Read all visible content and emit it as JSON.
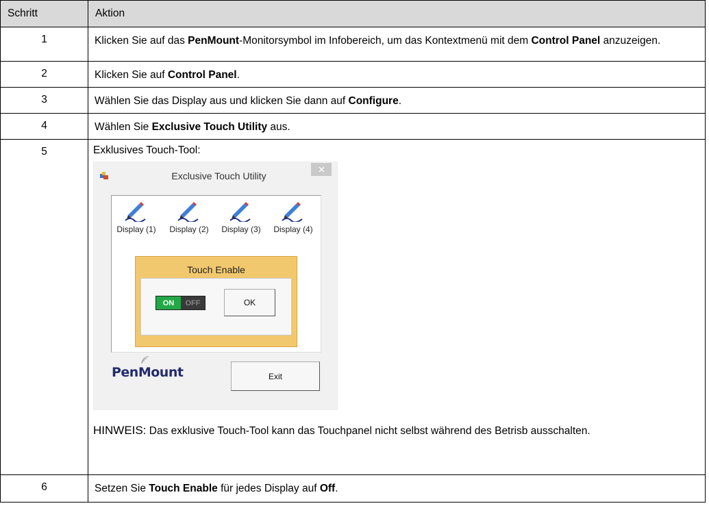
{
  "header": {
    "step": "Schritt",
    "action": "Aktion"
  },
  "rows": [
    {
      "num": "1",
      "parts": [
        {
          "t": "Klicken Sie auf das ",
          "b": false
        },
        {
          "t": "PenMount",
          "b": true
        },
        {
          "t": "-Monitorsymbol im Infobereich, um das Kontextmenü mit dem ",
          "b": false
        },
        {
          "t": "Control Panel",
          "b": true
        },
        {
          "t": " anzuzeigen.",
          "b": false
        }
      ]
    },
    {
      "num": "2",
      "parts": [
        {
          "t": "Klicken Sie auf ",
          "b": false
        },
        {
          "t": "Control Panel",
          "b": true
        },
        {
          "t": ".",
          "b": false
        }
      ]
    },
    {
      "num": "3",
      "parts": [
        {
          "t": "Wählen Sie das Display aus und klicken Sie dann auf ",
          "b": false
        },
        {
          "t": "Configure",
          "b": true
        },
        {
          "t": ".",
          "b": false
        }
      ]
    },
    {
      "num": "4",
      "parts": [
        {
          "t": "Wählen Sie ",
          "b": false
        },
        {
          "t": "Exclusive Touch Utility",
          "b": true
        },
        {
          "t": " aus.",
          "b": false
        }
      ]
    },
    {
      "num": "5"
    },
    {
      "num": "6",
      "parts": [
        {
          "t": "Setzen Sie ",
          "b": false
        },
        {
          "t": "Touch Enable",
          "b": true
        },
        {
          "t": " für jedes Display auf ",
          "b": false
        },
        {
          "t": "Off",
          "b": true
        },
        {
          "t": ".",
          "b": false
        }
      ]
    }
  ],
  "step5": {
    "intro": "Exklusives Touch-Tool:",
    "note_label": "HINWEIS:",
    "note_text": " Das exklusive Touch-Tool kann das Touchpanel nicht selbst während des Betrisb ausschalten."
  },
  "dialog": {
    "title": "Exclusive Touch Utility",
    "displays": [
      "Display (1)",
      "Display (2)",
      "Display (3)",
      "Display (4)"
    ],
    "touch_enable_label": "Touch Enable",
    "toggle_on": "ON",
    "toggle_off": "OFF",
    "toggle_state": "on",
    "ok_label": "OK",
    "exit_label": "Exit",
    "logo_text_pen": "Pen",
    "logo_text_mount": "Mount"
  },
  "colors": {
    "header_bg": "#d9d9d9",
    "toggle_on": "#22a846",
    "touch_enable_bg": "#f2c86e",
    "logo": "#232b6e"
  }
}
